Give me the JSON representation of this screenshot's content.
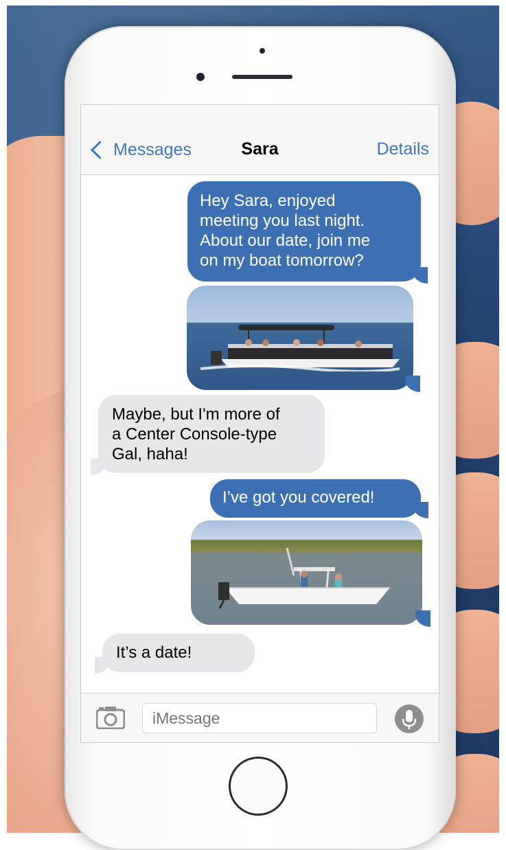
{
  "navbar": {
    "back_label": "Messages",
    "contact_name": "Sara",
    "details_label": "Details"
  },
  "conversation": {
    "messages": [
      {
        "from": "me",
        "type": "text",
        "lines": [
          "Hey Sara, enjoyed",
          "meeting you last night.",
          "About our date, join me",
          "on my boat tomorrow?"
        ]
      },
      {
        "from": "me",
        "type": "image",
        "depicts": "pontoon boat with passengers"
      },
      {
        "from": "sara",
        "type": "text",
        "lines": [
          "Maybe, but I'm more of",
          "a Center Console-type",
          "Gal, haha!"
        ]
      },
      {
        "from": "me",
        "type": "text",
        "lines": [
          "I’ve got you covered!"
        ]
      },
      {
        "from": "me",
        "type": "image",
        "depicts": "center console boat"
      },
      {
        "from": "sara",
        "type": "text",
        "lines": [
          "It’s a date!"
        ]
      }
    ]
  },
  "input_bar": {
    "placeholder": "iMessage",
    "camera_icon": "camera-icon",
    "mic_icon": "microphone-icon"
  },
  "colors": {
    "outgoing_bubble": "#3d6fb3",
    "incoming_bubble": "#e5e5ea",
    "link_blue": "#3f76bf"
  }
}
